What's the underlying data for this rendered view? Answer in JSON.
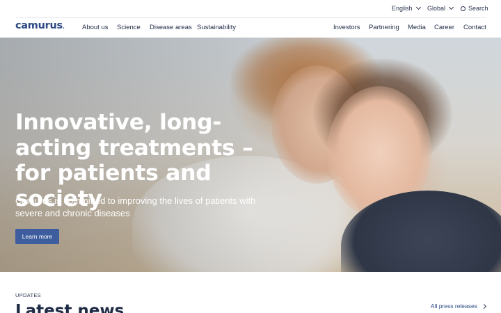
{
  "utility": {
    "language": "English",
    "region": "Global",
    "search": "Search"
  },
  "nav": {
    "logo": "camurus",
    "left_items": [
      "About us",
      "Science",
      "Disease areas",
      "Sustainability"
    ],
    "right_items": [
      "Investors",
      "Partnering",
      "Media",
      "Career",
      "Contact"
    ]
  },
  "hero": {
    "title": "Innovative, long-acting treatments – for patients and society",
    "subtitle": "Camurus is committed to improving the lives of patients with severe and chronic diseases",
    "cta": "Learn more"
  },
  "updates": {
    "label": "UPDATES",
    "title": "Latest news",
    "all_link": "All press releases"
  },
  "colors": {
    "brand": "#2e4a86",
    "button": "#3e5d9e"
  },
  "icons": {
    "language_dropdown": "chevron-down-icon",
    "region_dropdown": "chevron-down-icon",
    "search": "search-icon",
    "press_link": "chevron-right-icon"
  }
}
